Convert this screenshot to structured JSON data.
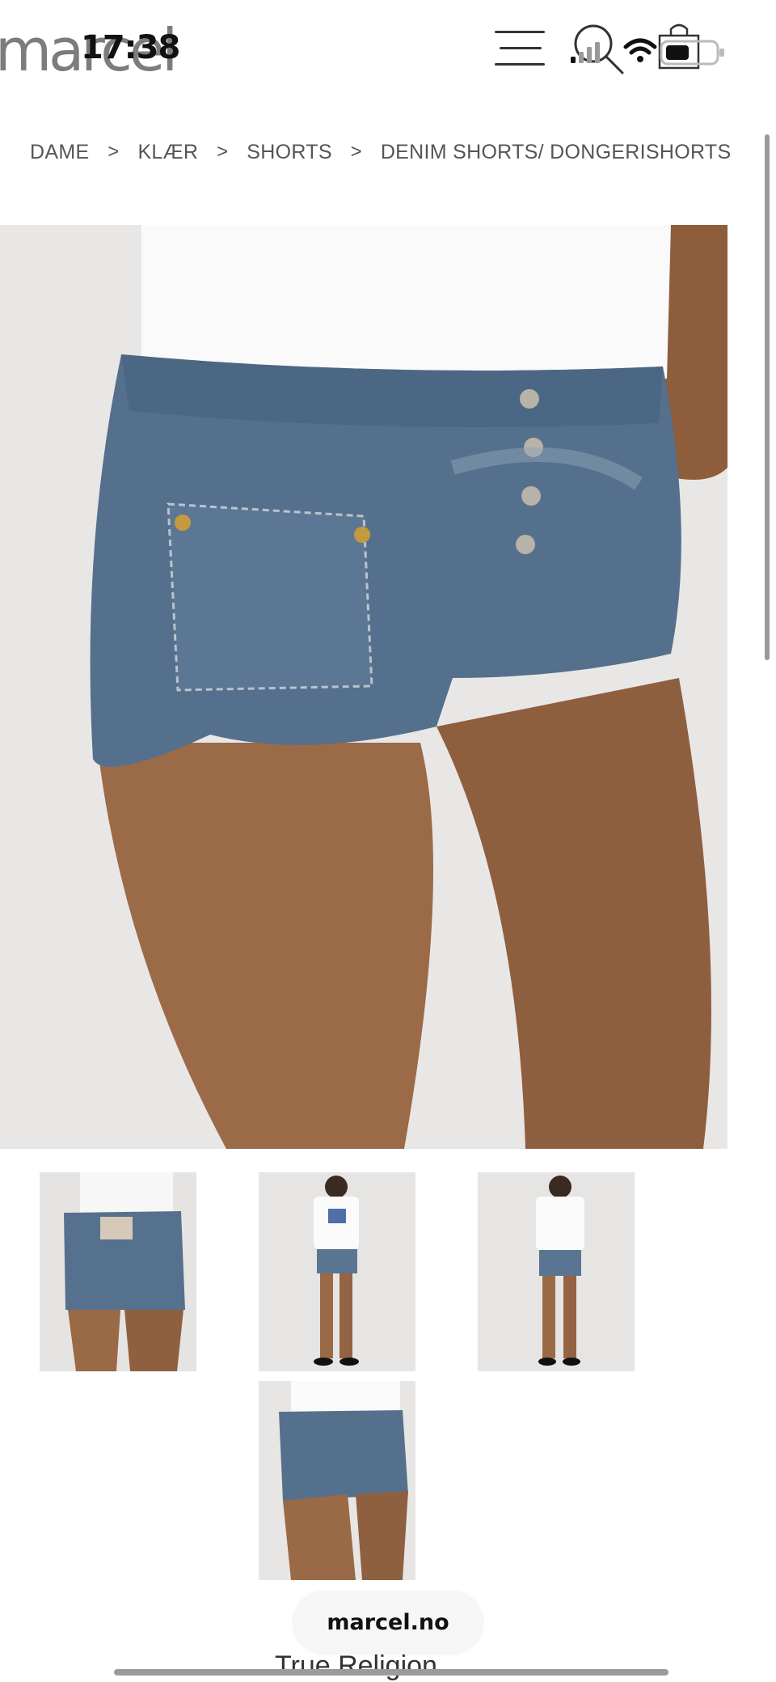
{
  "status_bar": {
    "time": "17:38"
  },
  "header": {
    "logo": "marcel",
    "icons": [
      "menu-icon",
      "search-icon",
      "bag-icon"
    ]
  },
  "breadcrumb": {
    "items": [
      "DAME",
      "KLÆR",
      "SHORTS",
      "DENIM SHORTS/ DONGERISHORTS"
    ],
    "separator": ">"
  },
  "product": {
    "brand": "True Religion"
  },
  "browser": {
    "url": "marcel.no"
  },
  "colors": {
    "denim": "#55708c",
    "skin": "#9b6a47",
    "background": "#e8e6e4"
  }
}
